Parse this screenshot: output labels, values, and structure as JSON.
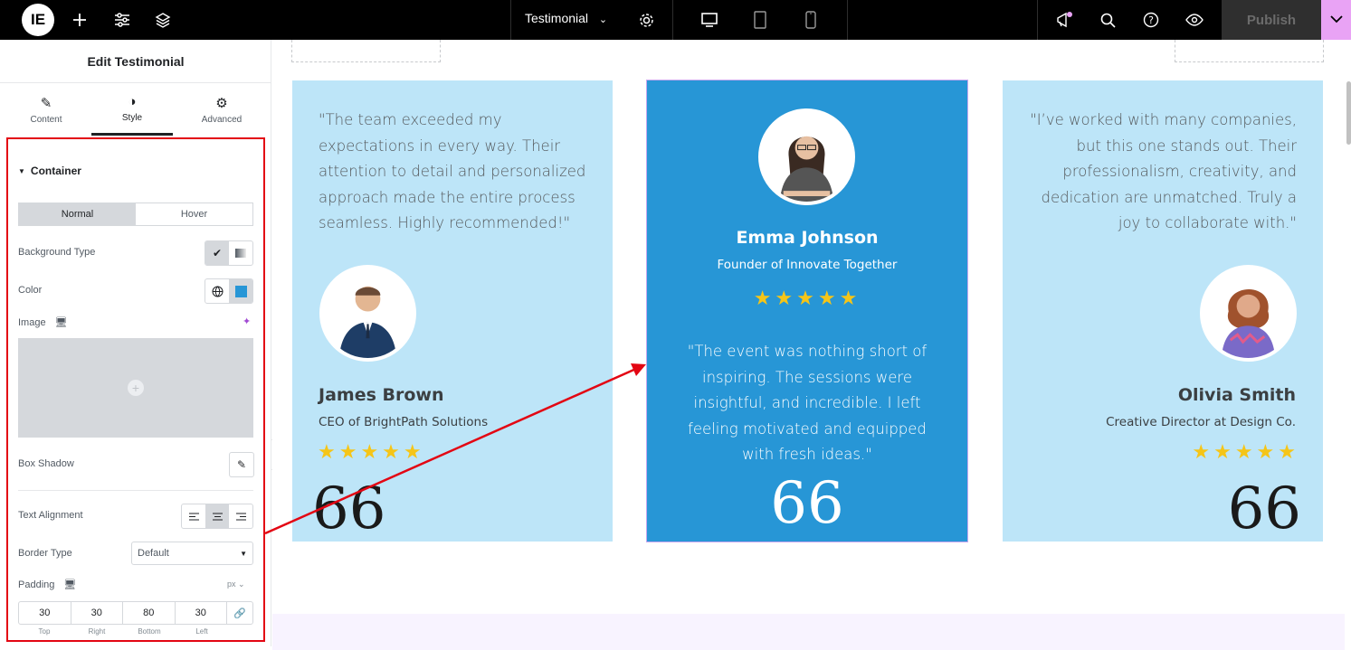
{
  "topbar": {
    "logo": "IE",
    "document_title": "Testimonial",
    "publish_label": "Publish",
    "accent_color": "#e9a3f5"
  },
  "panel": {
    "title": "Edit Testimonial",
    "tabs": [
      {
        "label": "Content",
        "icon": "pencil-icon"
      },
      {
        "label": "Style",
        "icon": "contrast-icon"
      },
      {
        "label": "Advanced",
        "icon": "gear-icon"
      }
    ],
    "section_title": "Container",
    "state_tabs": [
      "Normal",
      "Hover"
    ],
    "background_type_label": "Background Type",
    "color_label": "Color",
    "image_label": "Image",
    "box_shadow_label": "Box Shadow",
    "text_alignment_label": "Text Alignment",
    "border_type_label": "Border Type",
    "border_type_value": "Default",
    "padding_label": "Padding",
    "padding_unit": "px",
    "padding": {
      "top": "30",
      "right": "30",
      "bottom": "80",
      "left": "30"
    },
    "padding_side_labels": [
      "Top",
      "Right",
      "Bottom",
      "Left"
    ],
    "swatch_color": "#2796d6",
    "highlight_color": "#e30613"
  },
  "testimonials": [
    {
      "quote": "\"The team exceeded my expectations in every way. Their attention to detail and personalized approach made the entire process seamless. Highly recommended!\"",
      "name": "James Brown",
      "role": "CEO of BrightPath Solutions",
      "stars": "★★★★★",
      "quote_mark": "66",
      "background": "#bde5f8"
    },
    {
      "quote": "\"The event was nothing short of inspiring. The sessions were insightful, and incredible. I left feeling motivated and equipped with fresh ideas.\"",
      "name": "Emma Johnson",
      "role": "Founder of Innovate Together",
      "stars": "★★★★★",
      "quote_mark": "66",
      "background": "#2796d6"
    },
    {
      "quote": "\"I’ve worked with many companies, but this one stands out. Their professionalism, creativity, and dedication are unmatched. Truly a joy to collaborate with.\"",
      "name": "Olivia Smith",
      "role": "Creative Director at Design Co.",
      "stars": "★★★★★",
      "quote_mark": "66",
      "background": "#bde5f8"
    }
  ]
}
